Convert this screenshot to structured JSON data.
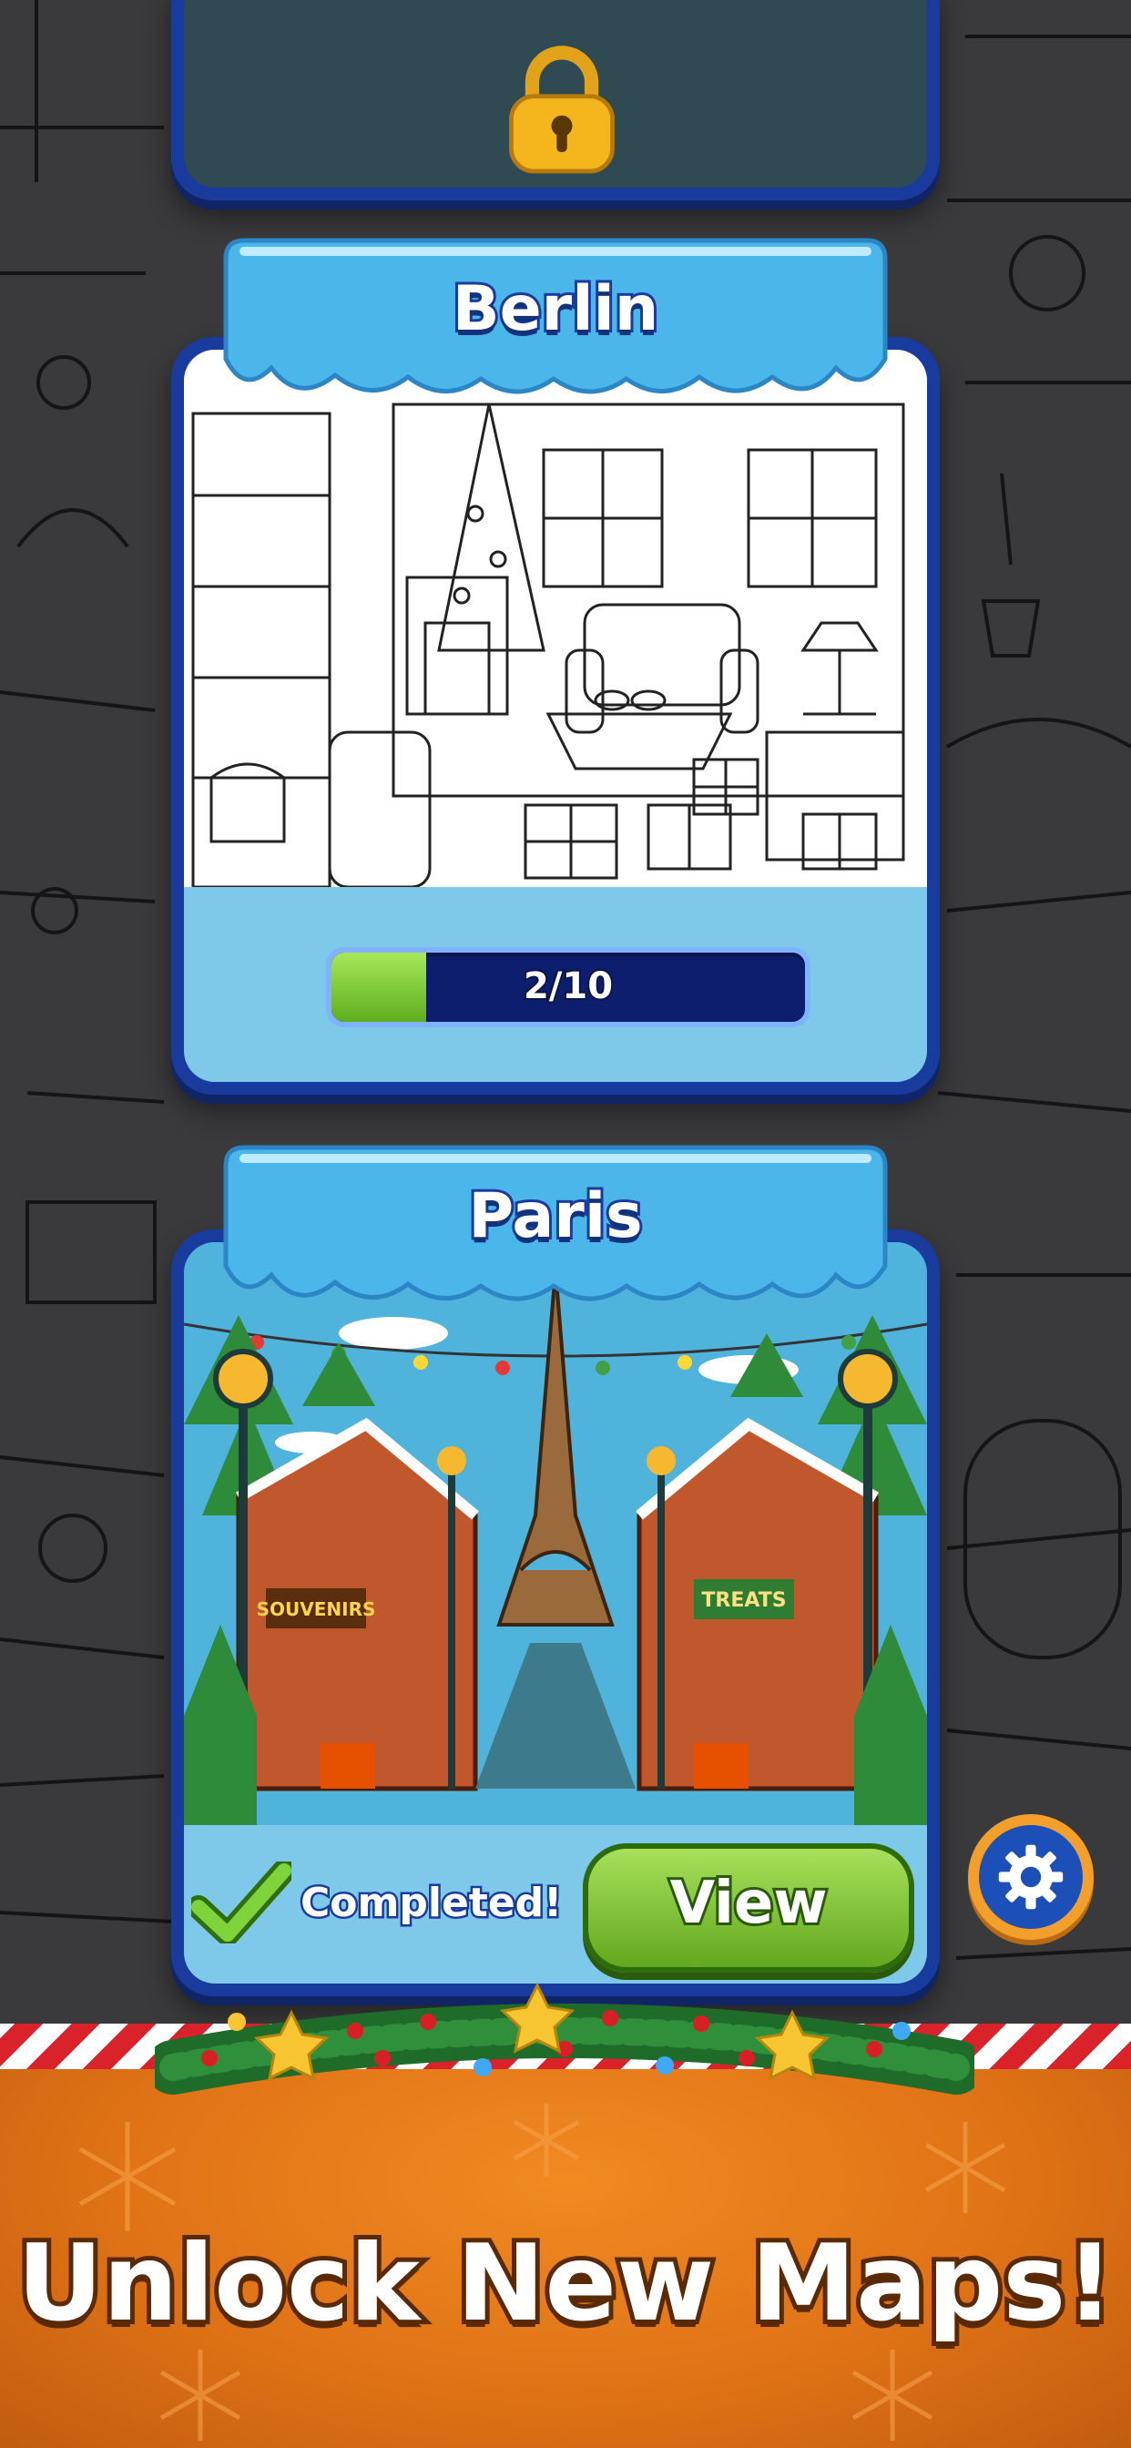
{
  "maps": [
    {
      "name": "",
      "locked": true
    },
    {
      "name": "Berlin",
      "progress_text": "2/10",
      "progress_fraction": 0.2
    },
    {
      "name": "Paris",
      "status_text": "Completed!",
      "view_label": "View",
      "completed": true
    }
  ],
  "paris_scene": {
    "sign_left": "SOUVENIRS",
    "sign_right": "TREATS"
  },
  "headline": "Unlock New Maps!",
  "icons": [
    "lock-icon",
    "checkmark-icon",
    "gear-icon"
  ],
  "colors": {
    "card_border": "#1a3b9e",
    "banner": "#4ab6ea",
    "progress_fill": "#7fd035",
    "view_button": "#8bc83a",
    "bottom_banner": "#e07316",
    "settings_ring": "#f29f2b"
  }
}
